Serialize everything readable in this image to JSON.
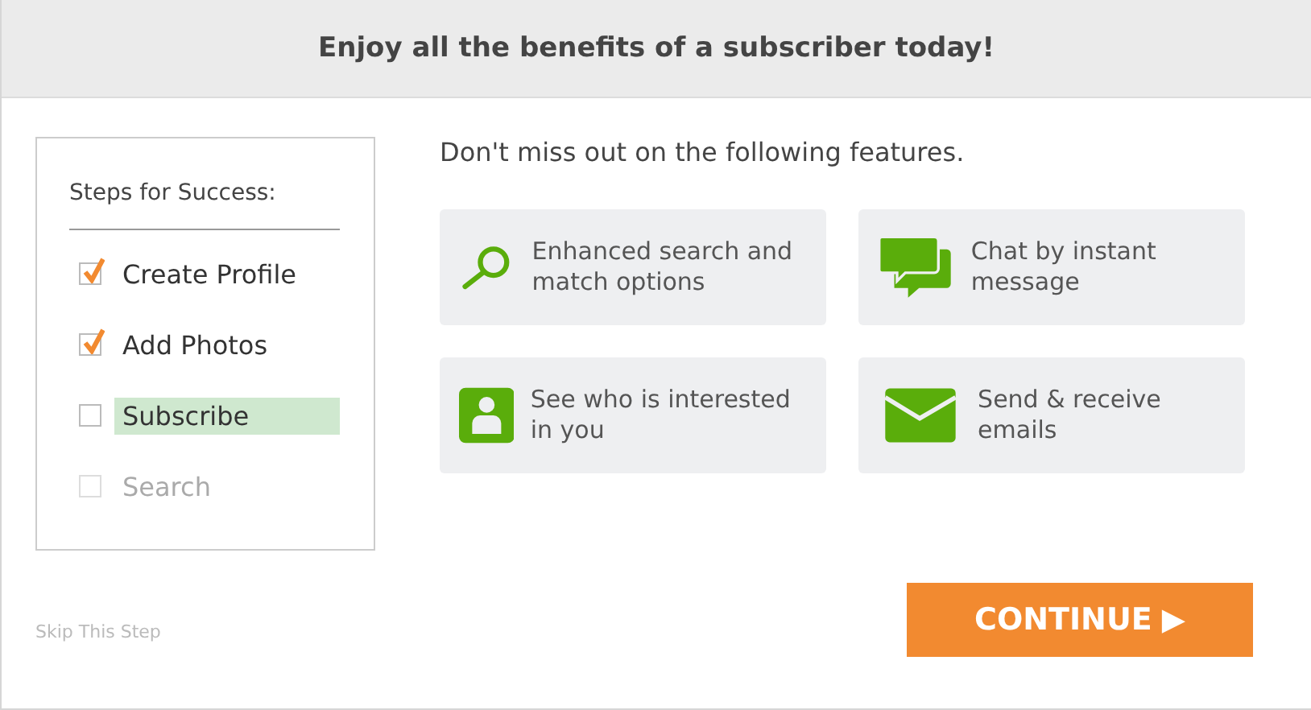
{
  "header": {
    "title": "Enjoy all the benefits of a subscriber today!"
  },
  "steps": {
    "title": "Steps for Success:",
    "items": [
      {
        "label": "Create Profile",
        "checked": true,
        "selected": false,
        "disabled": false
      },
      {
        "label": "Add Photos",
        "checked": true,
        "selected": false,
        "disabled": false
      },
      {
        "label": "Subscribe",
        "checked": false,
        "selected": true,
        "disabled": false
      },
      {
        "label": "Search",
        "checked": false,
        "selected": false,
        "disabled": true
      }
    ]
  },
  "skip_link": "Skip This Step",
  "features": {
    "heading": "Don't miss out on the following features.",
    "items": [
      {
        "kind": "search",
        "label": "Enhanced search and match options"
      },
      {
        "kind": "chat",
        "label": "Chat by instant message"
      },
      {
        "kind": "person",
        "label": "See who is interested in you"
      },
      {
        "kind": "mail",
        "label": "Send & receive emails"
      }
    ]
  },
  "continue_button": {
    "label": "CONTINUE",
    "arrow": "▶"
  }
}
